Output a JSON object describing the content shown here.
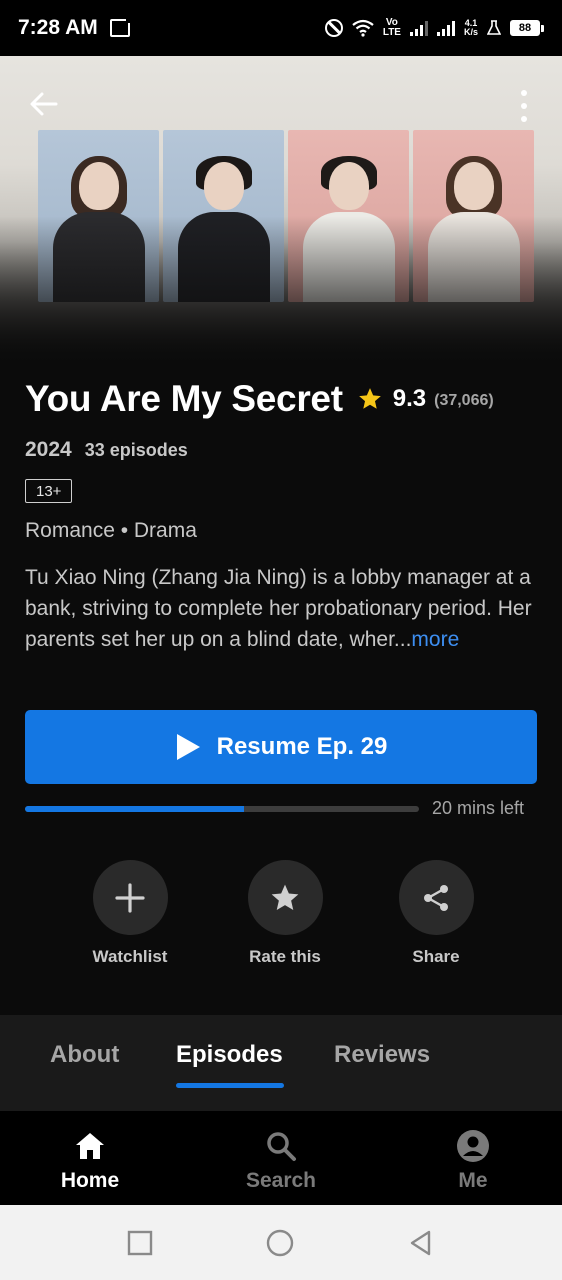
{
  "status_bar": {
    "time": "7:28 AM",
    "volte": "Vo LTE",
    "net_speed": "4.1 K/s",
    "battery": "88"
  },
  "hero": {
    "icons": [
      "back-arrow-icon",
      "more-vertical-icon"
    ]
  },
  "show": {
    "title": "You Are My Secret",
    "rating": "9.3",
    "rating_count": "(37,066)",
    "year": "2024",
    "episodes": "33 episodes",
    "age_rating": "13+",
    "genres": "Romance • Drama",
    "synopsis": "Tu Xiao Ning (Zhang Jia Ning) is a lobby manager at a bank, striving to complete her probationary period. Her parents set her up on a blind date, wher...",
    "more_label": "more"
  },
  "resume": {
    "label": "Resume Ep. 29",
    "progress_fraction": 0.555,
    "time_left": "20 mins left"
  },
  "actions": [
    {
      "label": "Watchlist",
      "icon": "plus-icon"
    },
    {
      "label": "Rate this",
      "icon": "star-icon"
    },
    {
      "label": "Share",
      "icon": "share-icon"
    }
  ],
  "tabs": [
    {
      "label": "About",
      "active": false
    },
    {
      "label": "Episodes",
      "active": true
    },
    {
      "label": "Reviews",
      "active": false
    }
  ],
  "bottom_nav": [
    {
      "label": "Home",
      "icon": "home-icon",
      "active": true
    },
    {
      "label": "Search",
      "icon": "search-icon",
      "active": false
    },
    {
      "label": "Me",
      "icon": "account-icon",
      "active": false
    }
  ],
  "colors": {
    "accent": "#1477e3",
    "star": "#f5c518",
    "link": "#3d8ef0",
    "background": "#0b0b0b"
  }
}
